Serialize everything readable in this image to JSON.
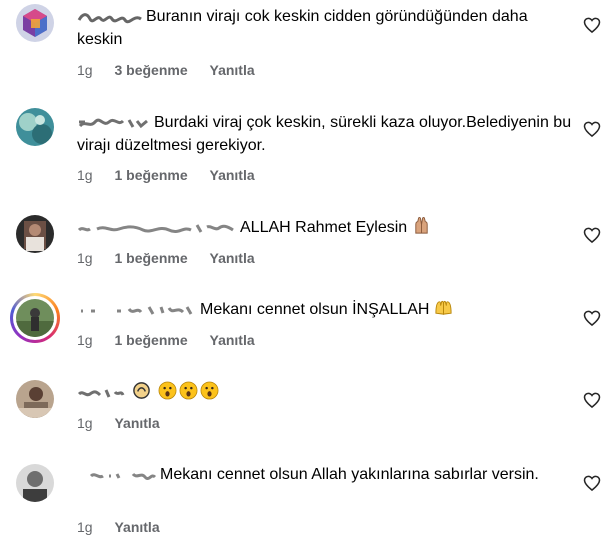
{
  "comments": [
    {
      "text": "Buranın virajı cok keskin cidden göründüğünden daha keskin",
      "age": "1g",
      "likes": "3 beğenme",
      "reply": "Yanıtla",
      "avatar_icon": "cube-avatar-icon"
    },
    {
      "text": "Burdaki viraj çok keskin, sürekli kaza oluyor.Belediyenin bu virajı düzeltmesi gerekiyor.",
      "age": "1g",
      "likes": "1 beğenme",
      "reply": "Yanıtla",
      "avatar_icon": "photo-avatar-icon"
    },
    {
      "text": "ALLAH Rahmet Eylesin",
      "age": "1g",
      "likes": "1 beğenme",
      "reply": "Yanıtla",
      "avatar_icon": "photo-avatar-icon",
      "emoji": "folded-hands-emoji"
    },
    {
      "text": "Mekanı cennet olsun İNŞALLAH",
      "age": "1g",
      "likes": "1 beğenme",
      "reply": "Yanıtla",
      "avatar_icon": "story-ring-avatar-icon",
      "emoji": "open-hands-emoji"
    },
    {
      "text": "",
      "age": "1g",
      "reply": "Yanıtla",
      "avatar_icon": "photo-avatar-icon",
      "emoji": "astonished-face-emoji"
    },
    {
      "text": "Mekanı cennet olsun Allah yakınlarına sabırlar versin.",
      "age": "1g",
      "reply": "Yanıtla",
      "avatar_icon": "photo-avatar-icon"
    }
  ],
  "icons": {
    "like": "heart-outline-icon"
  },
  "colors": {
    "meta": "#65676b",
    "text": "#000000",
    "background": "#ffffff"
  }
}
